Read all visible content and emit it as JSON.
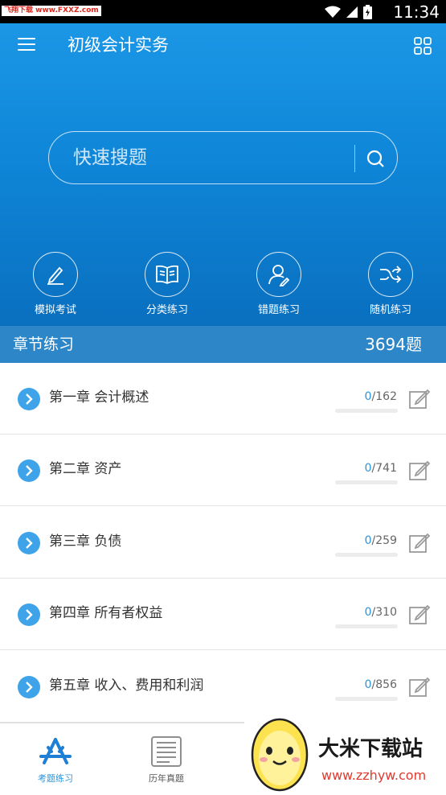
{
  "status_bar": {
    "watermark": "飞翔下载 www.FXXZ.com",
    "time": "11:34"
  },
  "header": {
    "title": "初级会计实务"
  },
  "search": {
    "placeholder": "快速搜题"
  },
  "quick_actions": [
    {
      "label": "模拟考试",
      "icon": "pencil-icon"
    },
    {
      "label": "分类练习",
      "icon": "book-icon"
    },
    {
      "label": "错题练习",
      "icon": "user-edit-icon"
    },
    {
      "label": "随机练习",
      "icon": "shuffle-icon"
    }
  ],
  "section": {
    "title": "章节练习",
    "count": "3694题"
  },
  "chapters": [
    {
      "name": "第一章 会计概述",
      "done": "0",
      "total": "/162",
      "progress": 0
    },
    {
      "name": "第二章 资产",
      "done": "0",
      "total": "/741",
      "progress": 0
    },
    {
      "name": "第三章 负债",
      "done": "0",
      "total": "/259",
      "progress": 0
    },
    {
      "name": "第四章 所有者权益",
      "done": "0",
      "total": "/310",
      "progress": 0
    },
    {
      "name": "第五章 收入、费用和利润",
      "done": "0",
      "total": "/856",
      "progress": 0
    }
  ],
  "bottom_nav": {
    "tabs": [
      {
        "label": "考题练习",
        "active": true,
        "icon": "app-store-icon"
      },
      {
        "label": "历年真题",
        "active": false,
        "icon": "document-icon"
      }
    ]
  },
  "brand": {
    "name": "大米下载站",
    "url": "www.zzhyw.com",
    "mascot": "rice-grain-mascot"
  },
  "colors": {
    "primary": "#1b97e6",
    "section_bar": "#2d86c8",
    "accent": "#2a93dc",
    "icon_gray": "#9a9a9a",
    "watermark_red": "#e1251b"
  }
}
